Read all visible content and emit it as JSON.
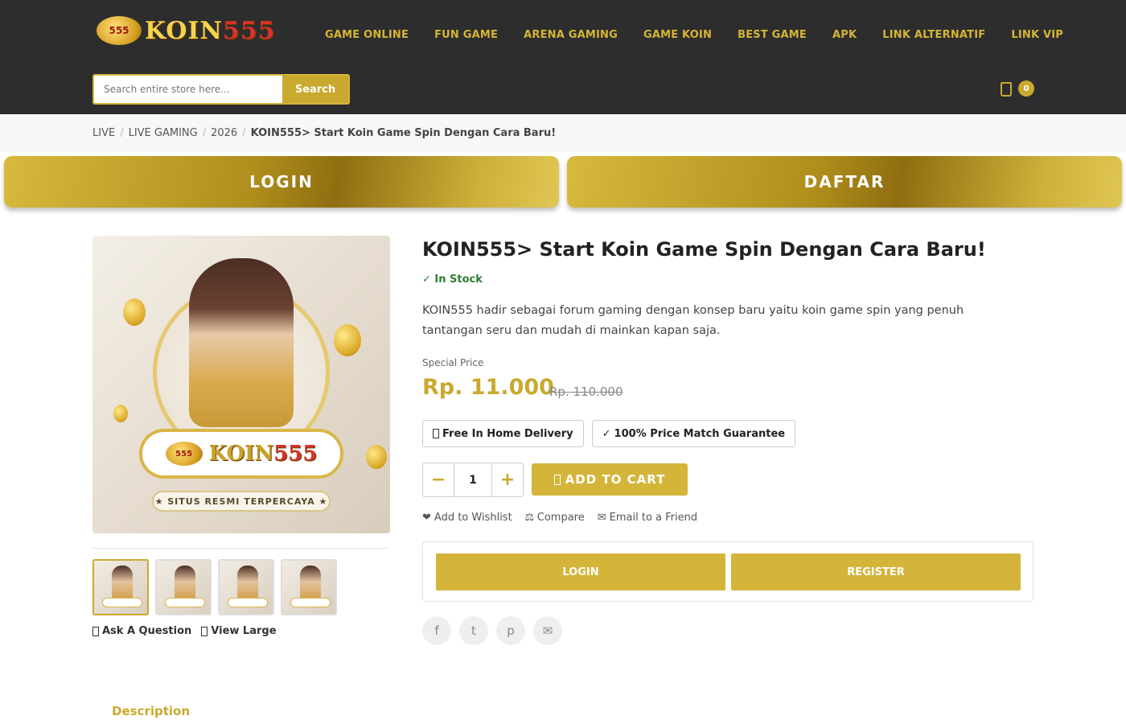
{
  "header": {
    "logo_text_a": "KOIN",
    "logo_text_b": "555",
    "logo_coin": "555",
    "nav": [
      "GAME ONLINE",
      "FUN GAME",
      "ARENA GAMING",
      "GAME KOIN",
      "BEST GAME",
      "APK",
      "LINK ALTERNATIF",
      "LINK VIP"
    ],
    "search": {
      "placeholder": "Search entire store here...",
      "button": "Search"
    },
    "cart_count": "0",
    "cart_icon": "cart-icon"
  },
  "breadcrumb": {
    "items": [
      "LIVE",
      "LIVE GAMING",
      "2026"
    ],
    "current": "KOIN555> Start Koin Game Spin Dengan Cara Baru!"
  },
  "cta": {
    "login": "LOGIN",
    "daftar": "DAFTAR"
  },
  "gallery": {
    "banner_a": "KOIN",
    "banner_b": "555",
    "banner_coin": "555",
    "tag": "★ SITUS RESMI TERPERCAYA ★",
    "links": {
      "ask": "Ask A Question",
      "view": "View Large"
    }
  },
  "product": {
    "title": "KOIN555> Start Koin Game Spin Dengan Cara Baru!",
    "stock": "✓ In Stock",
    "description": "KOIN555 hadir sebagai forum gaming dengan konsep baru yaitu koin game spin yang penuh tantangan seru dan mudah di mainkan kapan saja.",
    "price_label": "Special Price",
    "price": "Rp. 11.000",
    "old_price": "Rp. 110.000",
    "badges": {
      "delivery": "Free In Home Delivery",
      "guarantee": "100% Price Match Guarantee"
    },
    "qty": {
      "minus": "−",
      "value": "1",
      "plus": "+"
    },
    "add_to_cart": "ADD TO CART",
    "actions": {
      "wishlist": "Add to Wishlist",
      "compare": "Compare",
      "email": "Email to a Friend"
    },
    "auth": {
      "login": "LOGIN",
      "register": "REGISTER"
    },
    "social": [
      "f",
      "t",
      "p",
      "✉"
    ]
  },
  "tabs": {
    "description": "Description"
  },
  "colors": {
    "gold": "#c9a92e",
    "header_bg": "#2d2d2d",
    "stock_green": "#2e7d32"
  }
}
